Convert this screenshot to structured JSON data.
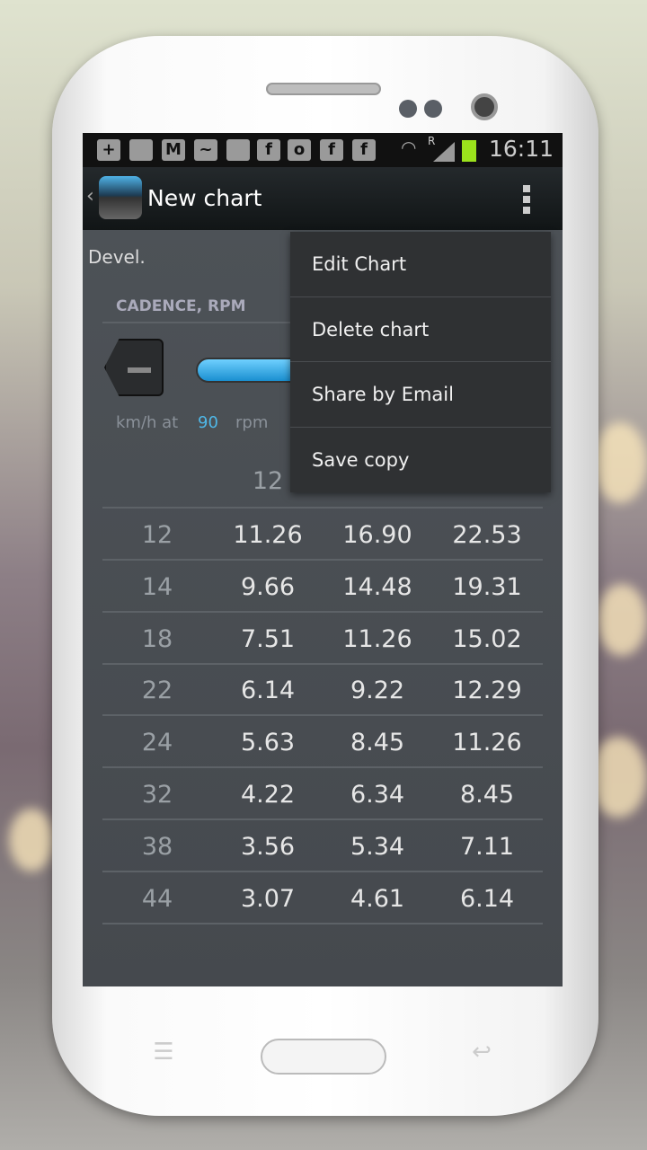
{
  "status_bar": {
    "time": "16:11",
    "roaming": "R",
    "icons": [
      "add-icon",
      "image-icon",
      "gmail-icon",
      "messenger-icon",
      "add-contact-icon",
      "facebook-icon",
      "sync-icon",
      "facebook-icon",
      "facebook-icon",
      "wifi-icon",
      "signal-icon",
      "battery-icon"
    ]
  },
  "action_bar": {
    "title": "New chart",
    "back": "‹"
  },
  "content": {
    "devel": "Devel.",
    "section": "CADENCE, RPM",
    "speed_label": "km/h at",
    "cadence_value": "90",
    "cadence_unit": "rpm",
    "accent": "#4fb8e8"
  },
  "table": {
    "header": [
      "12",
      "",
      ""
    ],
    "rows": [
      {
        "label": "12",
        "values": [
          "11.26",
          "16.90",
          "22.53"
        ]
      },
      {
        "label": "14",
        "values": [
          "9.66",
          "14.48",
          "19.31"
        ]
      },
      {
        "label": "18",
        "values": [
          "7.51",
          "11.26",
          "15.02"
        ]
      },
      {
        "label": "22",
        "values": [
          "6.14",
          "9.22",
          "12.29"
        ]
      },
      {
        "label": "24",
        "values": [
          "5.63",
          "8.45",
          "11.26"
        ]
      },
      {
        "label": "32",
        "values": [
          "4.22",
          "6.34",
          "8.45"
        ]
      },
      {
        "label": "38",
        "values": [
          "3.56",
          "5.34",
          "7.11"
        ]
      },
      {
        "label": "44",
        "values": [
          "3.07",
          "4.61",
          "6.14"
        ]
      }
    ]
  },
  "menu": {
    "items": [
      "Edit Chart",
      "Delete chart",
      "Share by Email",
      "Save copy"
    ]
  }
}
